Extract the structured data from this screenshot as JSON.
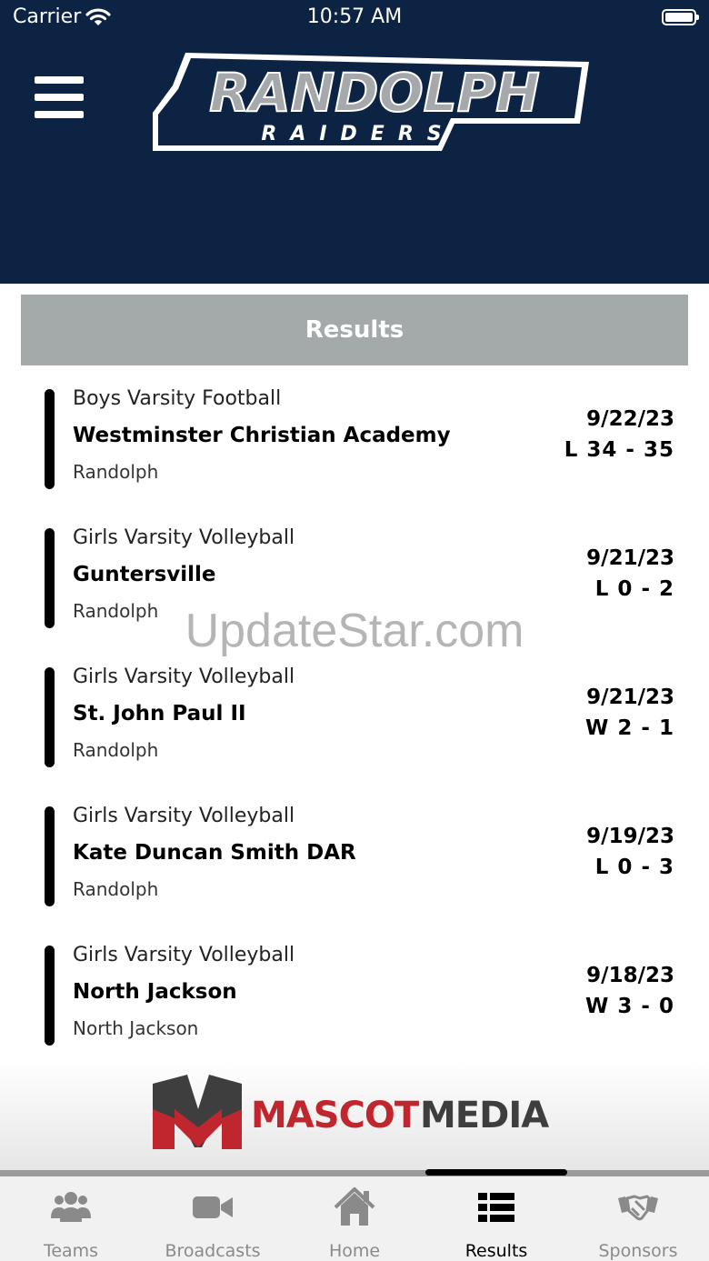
{
  "status_bar": {
    "carrier": "Carrier",
    "time": "10:57 AM"
  },
  "header": {
    "logo_title": "RANDOLPH",
    "logo_subtitle": "RAIDERS"
  },
  "section_title": "Results",
  "results": [
    {
      "sport": "Boys Varsity Football",
      "opponent": "Westminster Christian Academy",
      "team": "Randolph",
      "date": "9/22/23",
      "score": "L 34 - 35"
    },
    {
      "sport": "Girls Varsity Volleyball",
      "opponent": "Guntersville",
      "team": "Randolph",
      "date": "9/21/23",
      "score": "L 0 - 2"
    },
    {
      "sport": "Girls Varsity Volleyball",
      "opponent": "St. John Paul II",
      "team": "Randolph",
      "date": "9/21/23",
      "score": "W 2 - 1"
    },
    {
      "sport": "Girls Varsity Volleyball",
      "opponent": "Kate Duncan Smith DAR",
      "team": "Randolph",
      "date": "9/19/23",
      "score": "L 0 - 3"
    },
    {
      "sport": "Girls Varsity Volleyball",
      "opponent": "North Jackson",
      "team": "North Jackson",
      "date": "9/18/23",
      "score": "W 3 - 0"
    }
  ],
  "watermark": "UpdateStar.com",
  "sponsor": {
    "name_bold": "MASCOT",
    "name_light": "MEDIA"
  },
  "tabs": [
    {
      "label": "Teams",
      "icon": "people-icon"
    },
    {
      "label": "Broadcasts",
      "icon": "video-camera-icon"
    },
    {
      "label": "Home",
      "icon": "house-icon"
    },
    {
      "label": "Results",
      "icon": "list-icon"
    },
    {
      "label": "Sponsors",
      "icon": "handshake-icon"
    }
  ],
  "colors": {
    "header_bg": "#0d2343",
    "results_bar": "#a4aaaa",
    "sponsor_red": "#c0262d",
    "tab_inactive": "#8a8a8a"
  }
}
